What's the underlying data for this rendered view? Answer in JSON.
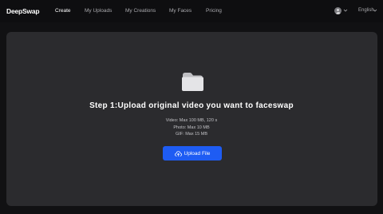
{
  "header": {
    "logo": "DeepSwap",
    "nav": [
      {
        "label": "Create",
        "active": true
      },
      {
        "label": "My Uploads",
        "active": false
      },
      {
        "label": "My Creations",
        "active": false
      },
      {
        "label": "My Faces",
        "active": false
      },
      {
        "label": "Pricing",
        "active": false
      }
    ],
    "avatar_icon": "user-avatar-icon",
    "language": "English"
  },
  "upload": {
    "icon": "folder-icon",
    "heading": "Step 1:Upload original video you want to faceswap",
    "limits": [
      "Video:  Max 100 MB, 120 s",
      "Photo: Max 10 MB",
      "GIF: Max 15 MB"
    ],
    "button_label": "Upload File",
    "button_icon": "cloud-upload-icon"
  },
  "colors": {
    "background": "#111113",
    "panel": "#2b2b2e",
    "accent": "#1e5cf3"
  }
}
